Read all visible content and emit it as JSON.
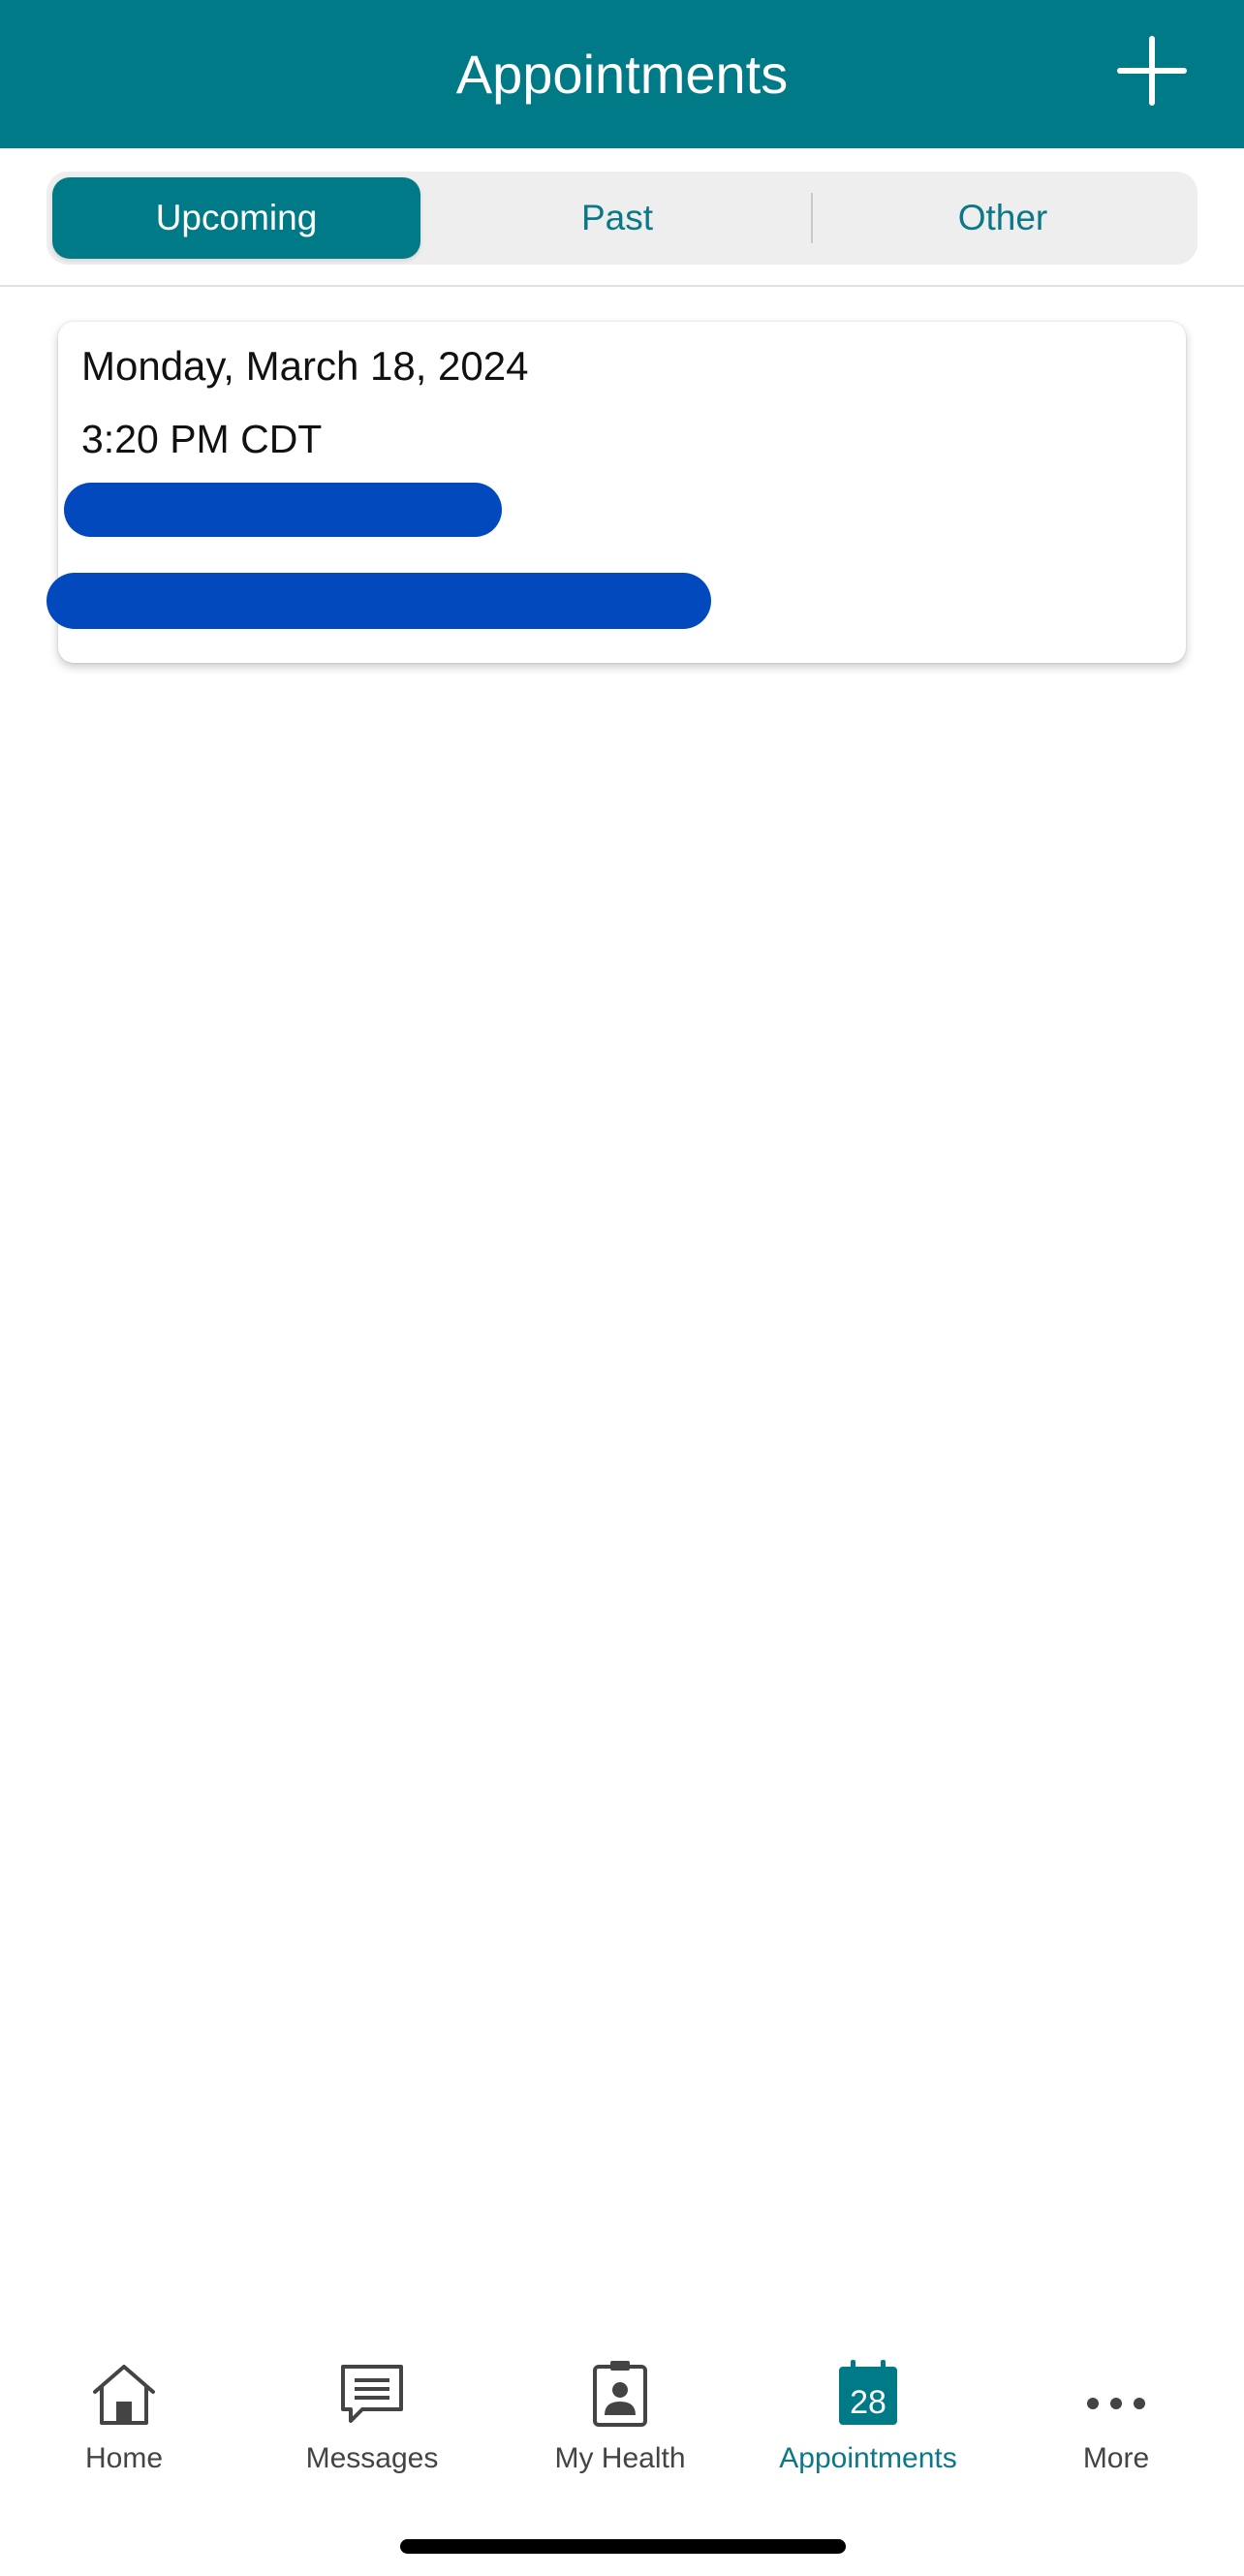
{
  "header": {
    "title": "Appointments",
    "add_icon": "plus-icon"
  },
  "tabs": [
    {
      "label": "Upcoming",
      "active": true
    },
    {
      "label": "Past",
      "active": false
    },
    {
      "label": "Other",
      "active": false
    }
  ],
  "appointments": [
    {
      "date": "Monday, March 18, 2024",
      "time": "3:20 PM CDT"
    }
  ],
  "nav": {
    "items": [
      {
        "label": "Home",
        "icon": "home-icon",
        "active": false
      },
      {
        "label": "Messages",
        "icon": "message-icon",
        "active": false
      },
      {
        "label": "My Health",
        "icon": "health-record-icon",
        "active": false
      },
      {
        "label": "Appointments",
        "icon": "calendar-icon",
        "active": true,
        "badge": "28"
      },
      {
        "label": "More",
        "icon": "more-icon",
        "active": false
      }
    ]
  },
  "colors": {
    "brand": "#017a87",
    "redaction": "#0349be",
    "inactive": "#444444"
  }
}
